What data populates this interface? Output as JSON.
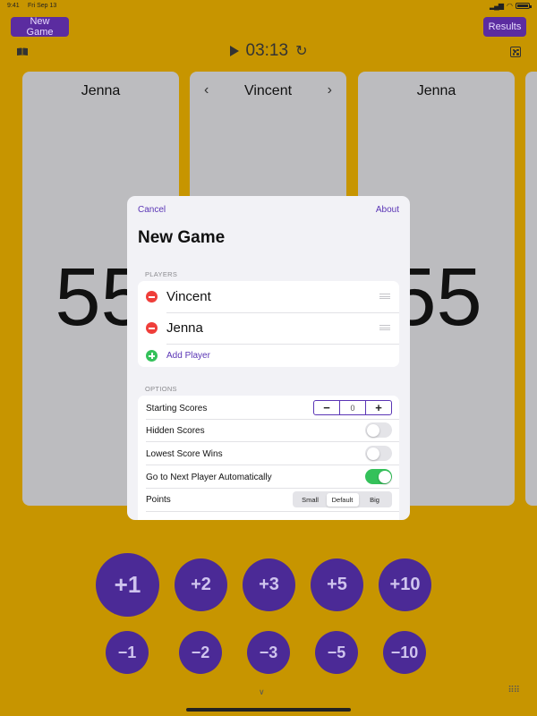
{
  "status_bar": {
    "time": "9:41",
    "date": "Fri Sep 13"
  },
  "toolbar": {
    "new_game_label": "New Game",
    "results_label": "Results"
  },
  "timer": {
    "value": "03:13"
  },
  "cards": [
    {
      "name": "Jenna",
      "score": "55"
    },
    {
      "name": "Vincent",
      "score": ""
    },
    {
      "name": "Jenna",
      "score": "55"
    }
  ],
  "score_buttons": {
    "positive": [
      "+1",
      "+2",
      "+3",
      "+5",
      "+10"
    ],
    "negative": [
      "−1",
      "−2",
      "−3",
      "−5",
      "−10"
    ]
  },
  "modal": {
    "cancel_label": "Cancel",
    "about_label": "About",
    "title": "New Game",
    "players_header": "PLAYERS",
    "players": [
      {
        "name": "Vincent"
      },
      {
        "name": "Jenna"
      }
    ],
    "add_player_label": "Add Player",
    "options_header": "OPTIONS",
    "options": {
      "starting_scores": {
        "label": "Starting Scores",
        "value": "0",
        "minus": "−",
        "plus": "+"
      },
      "hidden_scores": {
        "label": "Hidden Scores",
        "on": false
      },
      "lowest_score_wins": {
        "label": "Lowest Score Wins",
        "on": false
      },
      "auto_next": {
        "label": "Go to Next Player Automatically",
        "on": true
      },
      "points": {
        "label": "Points",
        "options": [
          "Small",
          "Default",
          "Big"
        ],
        "selected": "Default"
      }
    }
  },
  "colors": {
    "background": "#c79500",
    "accent": "#5a35b5",
    "button": "#4b2a96",
    "card": "#bcbcbf",
    "delete": "#ef3e3a",
    "toggle_on": "#34c15a"
  }
}
